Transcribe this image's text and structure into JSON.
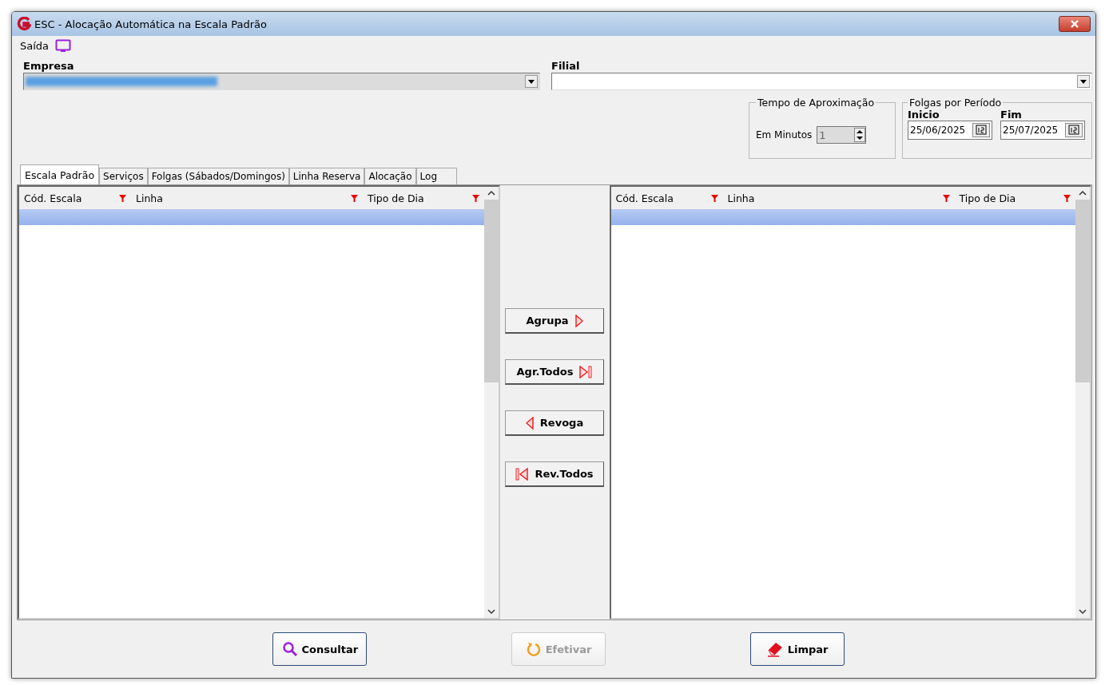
{
  "window": {
    "title": "ESC - Alocação Automática na Escala Padrão"
  },
  "menu": {
    "label": "Saída"
  },
  "empresa": {
    "label": "Empresa",
    "redacted": true
  },
  "filial": {
    "label": "Filial"
  },
  "tempo": {
    "title": "Tempo de Aproximação",
    "label": "Em Minutos",
    "value": "1",
    "disabled": true
  },
  "folgas": {
    "title": "Folgas por Período",
    "start_label": "Inicio",
    "start": "25/06/2025",
    "end_label": "Fim",
    "end": "25/07/2025"
  },
  "tabs": [
    {
      "label": "Escala Padrão",
      "selected": true
    },
    {
      "label": "Serviços",
      "selected": false
    },
    {
      "label": "Folgas (Sábados/Domingos)",
      "selected": false
    },
    {
      "label": "Linha Reserva",
      "selected": false
    },
    {
      "label": "Alocação",
      "selected": false
    },
    {
      "label": "Log",
      "selected": false
    }
  ],
  "grids": [
    {
      "columns": [
        "Cód. Escala",
        "Linha",
        "Tipo de Dia"
      ],
      "rows": [
        {
          "selected": true
        }
      ]
    },
    {
      "columns": [
        "Cód. Escala",
        "Linha",
        "Tipo de Dia"
      ],
      "rows": [
        {
          "selected": true
        }
      ]
    }
  ],
  "transfer_buttons": [
    {
      "label": "Agrupa",
      "kind": "add"
    },
    {
      "label": "Agr.Todos",
      "kind": "add-all"
    },
    {
      "label": "Revoga",
      "kind": "remove"
    },
    {
      "label": "Rev.Todos",
      "kind": "remove-all"
    }
  ],
  "footer_buttons": [
    {
      "label": "Consultar",
      "kind": "search",
      "disabled": false
    },
    {
      "label": "Efetivar",
      "kind": "undo",
      "disabled": true
    },
    {
      "label": "Limpar",
      "kind": "eraser",
      "disabled": false
    }
  ]
}
